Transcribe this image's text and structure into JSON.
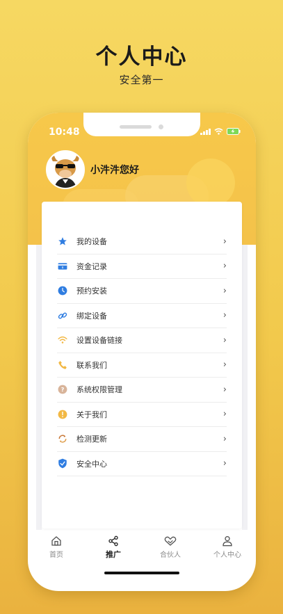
{
  "page": {
    "headline": "个人中心",
    "subline": "安全第一"
  },
  "status": {
    "time": "10:48"
  },
  "profile": {
    "greeting": "小汼汼您好"
  },
  "menu": [
    {
      "label": "我的设备",
      "icon": "star-icon",
      "color": "#2f7de1"
    },
    {
      "label": "资金记录",
      "icon": "wallet-icon",
      "color": "#2f7de1"
    },
    {
      "label": "预约安装",
      "icon": "clock-icon",
      "color": "#2f7de1"
    },
    {
      "label": "绑定设备",
      "icon": "link-icon",
      "color": "#2f7de1"
    },
    {
      "label": "设置设备链接",
      "icon": "wifi-icon",
      "color": "#f2b844"
    },
    {
      "label": "联系我们",
      "icon": "phone-icon",
      "color": "#f2b844"
    },
    {
      "label": "系统权限管理",
      "icon": "help-icon",
      "color": "#d8b49a"
    },
    {
      "label": "关于我们",
      "icon": "info-icon",
      "color": "#f2b844"
    },
    {
      "label": "检测更新",
      "icon": "refresh-icon",
      "color": "#c97a3a"
    },
    {
      "label": "安全中心",
      "icon": "shield-icon",
      "color": "#2f7de1"
    }
  ],
  "tabs": [
    {
      "label": "首页",
      "icon": "home-icon",
      "active": false
    },
    {
      "label": "推广",
      "icon": "share-icon",
      "active": true
    },
    {
      "label": "合伙人",
      "icon": "handshake-icon",
      "active": false
    },
    {
      "label": "个人中心",
      "icon": "person-icon",
      "active": false
    }
  ],
  "colors": {
    "accent": "#f4c24a",
    "primary_blue": "#2f7de1",
    "background": "#f2c94c"
  }
}
